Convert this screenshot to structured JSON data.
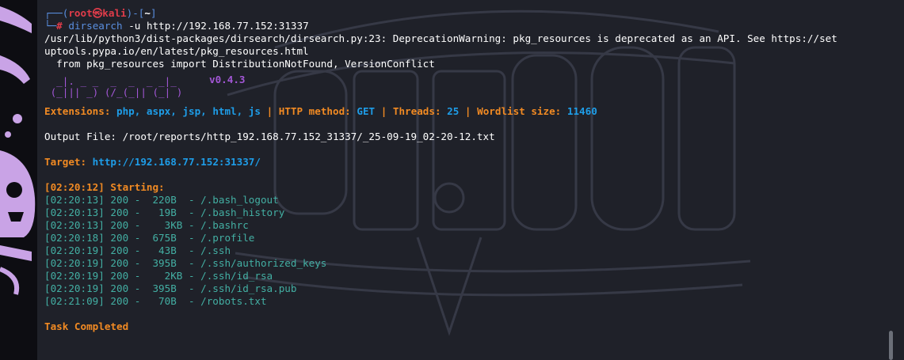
{
  "prompt": {
    "user": "root",
    "at": "㉿",
    "host": "kali",
    "dir": "~",
    "symbol": "#",
    "command": "dirsearch",
    "args": "-u http://192.168.77.152:31337"
  },
  "warning": [
    "/usr/lib/python3/dist-packages/dirsearch/dirsearch.py:23: DeprecationWarning: pkg_resources is deprecated as an API. See https://set",
    "uptools.pypa.io/en/latest/pkg_resources.html",
    "  from pkg_resources import DistributionNotFound, VersionConflict"
  ],
  "banner": {
    "art_line1": "  _|. _ _  _  _  _ _|_",
    "art_line2": " (_||| _) (/_(_|| (_| )",
    "version": "v0.4.3"
  },
  "config": {
    "extensions_label": "Extensions:",
    "extensions": "php, aspx, jsp, html, js",
    "sep": "|",
    "method_label": "HTTP method:",
    "method": "GET",
    "threads_label": "Threads:",
    "threads": "25",
    "wordlist_label": "Wordlist size:",
    "wordlist": "11460"
  },
  "output_file": "Output File: /root/reports/http_192.168.77.152_31337/_25-09-19_02-20-12.txt",
  "target": {
    "label": "Target:",
    "url": "http://192.168.77.152:31337/"
  },
  "starting": "[02:20:12] Starting:",
  "results": [
    "[02:20:13] 200 -  220B  - /.bash_logout",
    "[02:20:13] 200 -   19B  - /.bash_history",
    "[02:20:13] 200 -    3KB - /.bashrc",
    "[02:20:18] 200 -  675B  - /.profile",
    "[02:20:19] 200 -   43B  - /.ssh",
    "[02:20:19] 200 -  395B  - /.ssh/authorized_keys",
    "[02:20:19] 200 -    2KB - /.ssh/id_rsa",
    "[02:20:19] 200 -  395B  - /.ssh/id_rsa.pub",
    "[02:21:09] 200 -   70B  - /robots.txt"
  ],
  "done": "Task Completed",
  "colors": {
    "background": "#1f2129",
    "orange": "#f18a23",
    "cyan": "#1e9de8",
    "teal": "#43afa3",
    "purple": "#a357d6",
    "red": "#e03c4a"
  }
}
